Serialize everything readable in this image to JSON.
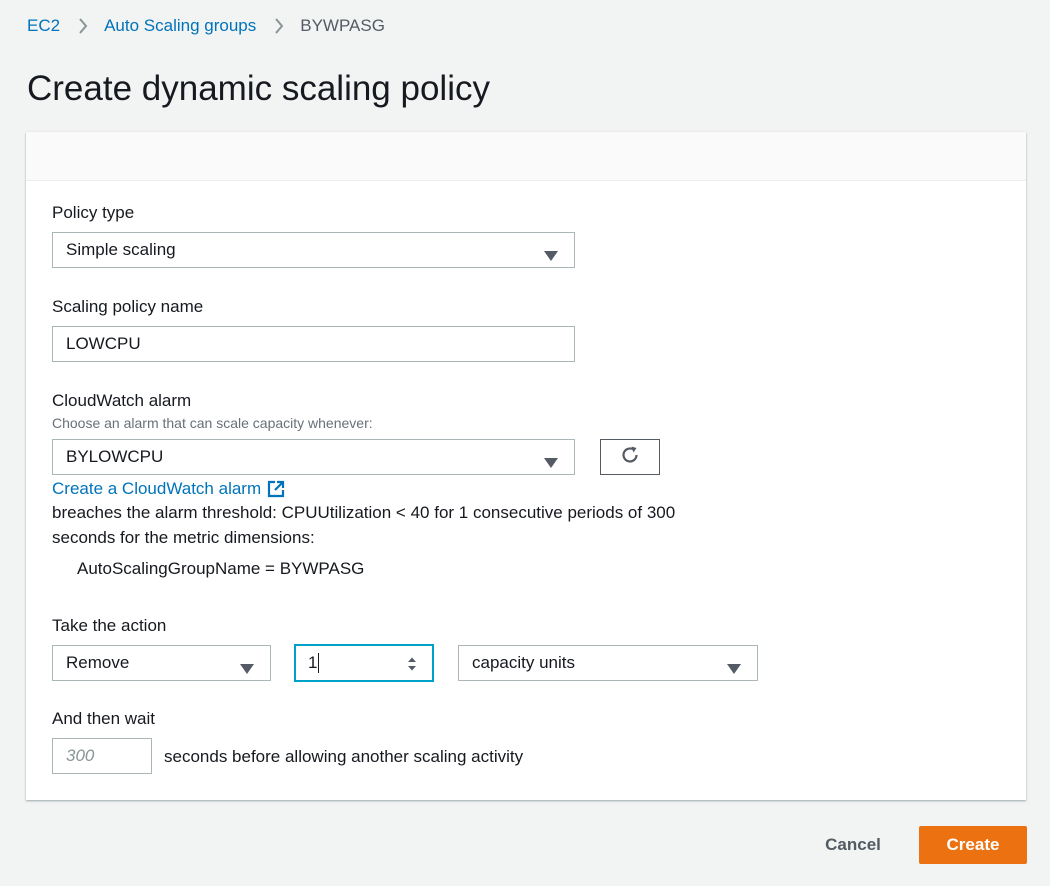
{
  "breadcrumb": {
    "items": [
      "EC2",
      "Auto Scaling groups"
    ],
    "current": "BYWPASG"
  },
  "page": {
    "title": "Create dynamic scaling policy"
  },
  "form": {
    "policy_type": {
      "label": "Policy type",
      "value": "Simple scaling"
    },
    "policy_name": {
      "label": "Scaling policy name",
      "value": "LOWCPU"
    },
    "alarm": {
      "label": "CloudWatch alarm",
      "description": "Choose an alarm that can scale capacity whenever:",
      "value": "BYLOWCPU",
      "create_link": "Create a CloudWatch alarm",
      "breach_line1": "breaches the alarm threshold: CPUUtilization < 40 for 1 consecutive periods of 300",
      "breach_line2": "seconds for the metric dimensions:",
      "dimension": "AutoScalingGroupName = BYWPASG"
    },
    "action": {
      "label": "Take the action",
      "operation": "Remove",
      "amount": "1",
      "unit": "capacity units"
    },
    "wait": {
      "label": "And then wait",
      "placeholder": "300",
      "suffix": "seconds before allowing another scaling activity"
    }
  },
  "footer": {
    "cancel_label": "Cancel",
    "create_label": "Create"
  },
  "icons": {
    "caret": "caret-down-icon",
    "refresh": "refresh-icon",
    "external": "external-link-icon",
    "separator": "chevron-right-icon",
    "spinner": "number-spinner-icon"
  },
  "colors": {
    "link": "#0073bb",
    "primary_button": "#ec7211",
    "focus_border": "#00a1c9",
    "input_border": "#aab7b8",
    "background": "#f2f3f3"
  }
}
